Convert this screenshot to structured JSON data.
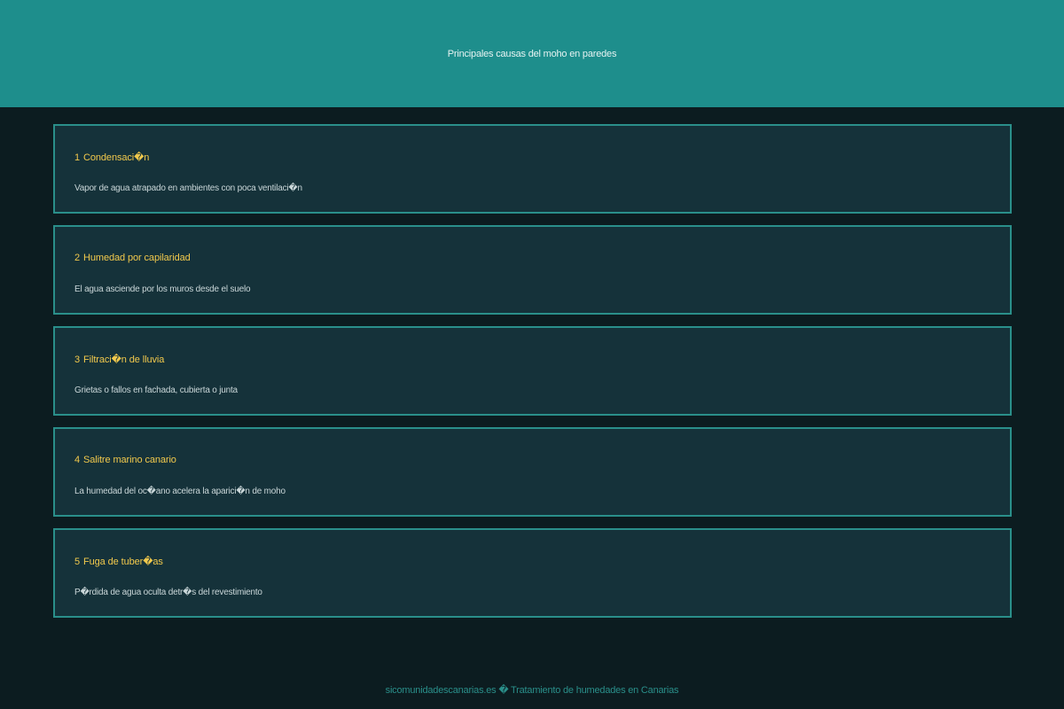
{
  "header": {
    "title": "Principales causas del moho en paredes"
  },
  "causes": [
    {
      "number": "1",
      "title": "Condensaci�n",
      "description": "Vapor de agua atrapado en ambientes con poca ventilaci�n"
    },
    {
      "number": "2",
      "title": "Humedad por capilaridad",
      "description": "El agua asciende por los muros desde el suelo"
    },
    {
      "number": "3",
      "title": "Filtraci�n de lluvia",
      "description": "Grietas o fallos en fachada, cubierta o junta"
    },
    {
      "number": "4",
      "title": "Salitre marino canario",
      "description": "La humedad del oc�ano acelera la aparici�n de moho"
    },
    {
      "number": "5",
      "title": "Fuga de tuber�as",
      "description": "P�rdida de agua oculta detr�s del revestimiento"
    }
  ],
  "footer": {
    "text": "sicomunidadescanarias.es � Tratamiento de humedades en Canarias"
  },
  "colors": {
    "header_bg": "#1e8e8c",
    "page_bg": "#0c1c20",
    "card_bg": "#15323a",
    "card_border": "#2a8f8a",
    "title_accent": "#f2c94c"
  }
}
